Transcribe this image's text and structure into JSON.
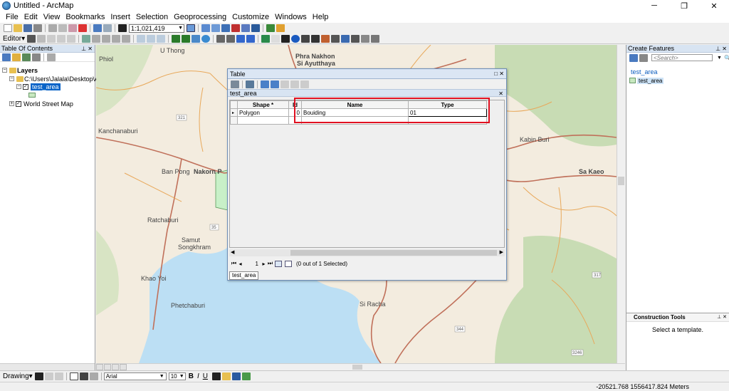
{
  "window": {
    "title": "Untitled - ArcMap",
    "controls": [
      "─",
      "❐",
      "✕"
    ]
  },
  "menu": [
    "File",
    "Edit",
    "View",
    "Bookmarks",
    "Insert",
    "Selection",
    "Geoprocessing",
    "Customize",
    "Windows",
    "Help"
  ],
  "toolbar": {
    "scale_value": "1:1,021,419",
    "editor_label": "Editor▾"
  },
  "toc": {
    "title": "Table Of Contents",
    "layers_label": "Layers",
    "path_label": "C:\\Users\\Jalala\\Desktop\\Arc",
    "selected_layer": "test_area",
    "basemap_label": "World Street Map"
  },
  "map": {
    "places": [
      "Phra Nakhon Si Ayutthaya",
      "Kanchanaburi",
      "Ban Pong",
      "Nakorn P",
      "Ratchaburi",
      "Samut Songkhram",
      "Khao Yoi",
      "Phetchaburi",
      "Kabin Buri",
      "Sa Kaeo",
      "Si Racha",
      "U Thong",
      "Phiol"
    ],
    "colors": {
      "land": "#f3ecdf",
      "water": "#bcdff4",
      "road_major": "#c0705a",
      "road_minor": "#e8a85a",
      "forest": "#c8dcb4",
      "polygon_fill": "#c8f0c8"
    }
  },
  "table_window": {
    "title": "Table",
    "tab_header": "test_area",
    "columns": [
      "Shape *",
      "Id",
      "Name",
      "Type"
    ],
    "row": {
      "shape": "Polygon",
      "id": "0",
      "name": "Bouiding",
      "type": "01"
    },
    "nav": {
      "current": "1",
      "status": "(0 out of 1 Selected)"
    },
    "tab_label": "test_area"
  },
  "create_features": {
    "title": "Create Features",
    "search_placeholder": "<Search>",
    "layer_name": "test_area",
    "template_name": "test_area"
  },
  "construction_tools": {
    "title": "Construction Tools",
    "message": "Select a template."
  },
  "drawing": {
    "label": "Drawing▾",
    "font": "Arial",
    "size": "10",
    "bold": "B",
    "italic": "I",
    "underline": "U"
  },
  "status": {
    "coords": "-20521.768  1556417.824 Meters"
  }
}
